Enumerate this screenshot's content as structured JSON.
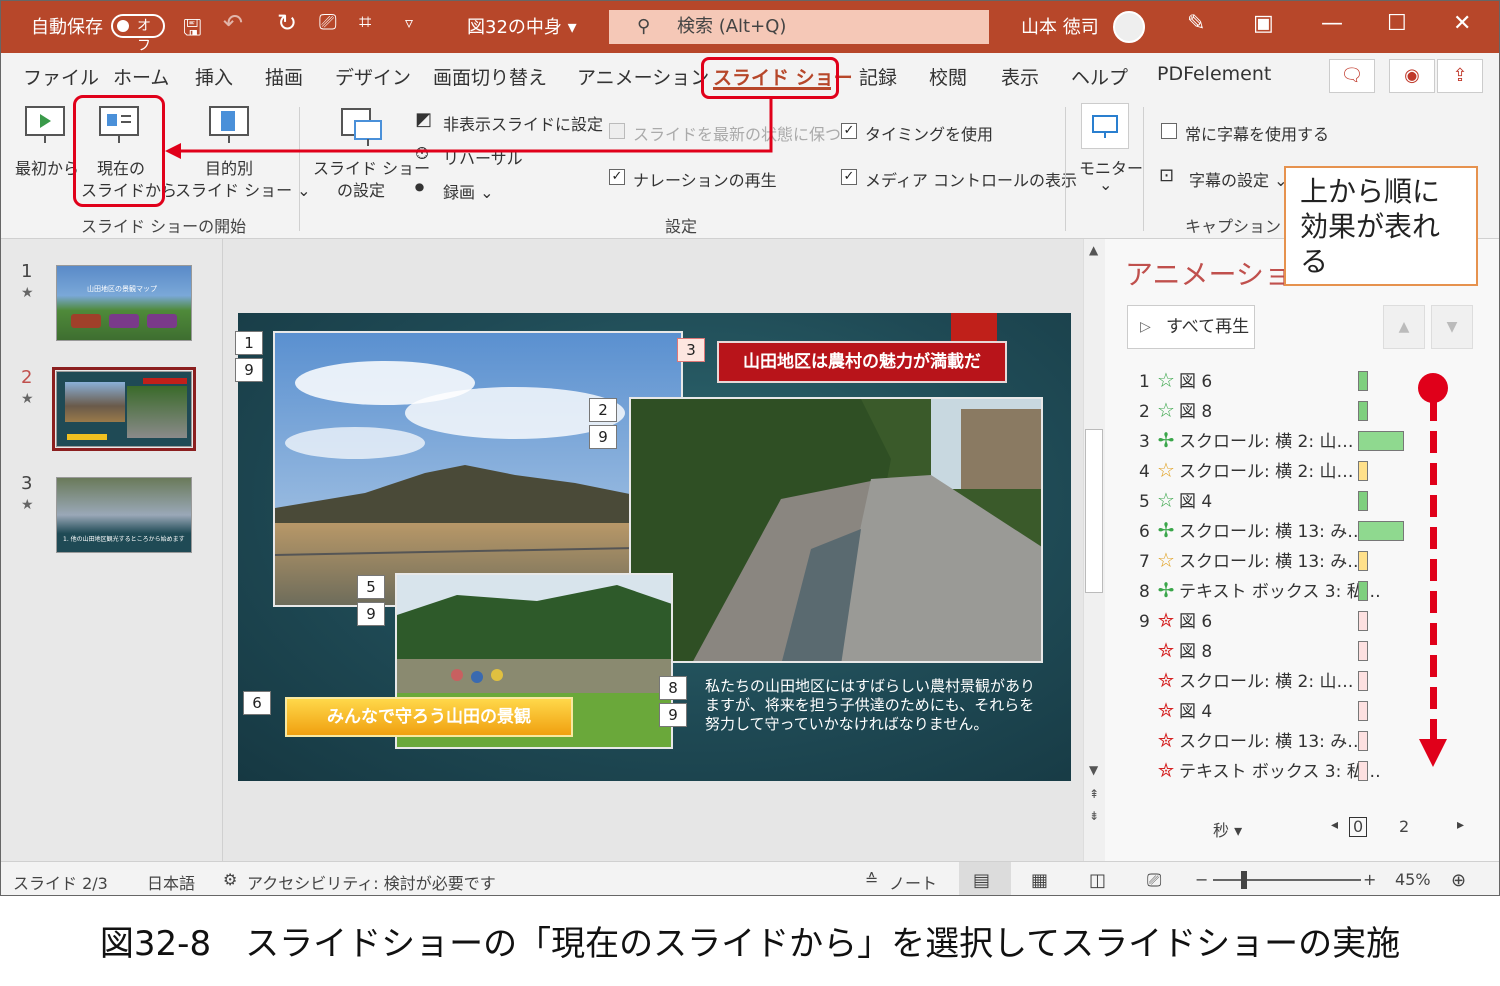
{
  "titlebar": {
    "autosave_label": "自動保存",
    "autosave_state": "オフ",
    "doc_title": "図32の中身",
    "search_placeholder": "検索 (Alt+Q)",
    "user_name": "山本 徳司"
  },
  "tabs": [
    "ファイル",
    "ホーム",
    "挿入",
    "描画",
    "デザイン",
    "画面切り替え",
    "アニメーション",
    "スライド ショー",
    "記録",
    "校閲",
    "表示",
    "ヘルプ",
    "PDFelement"
  ],
  "active_tab": "スライド ショー",
  "ribbon": {
    "start_group": {
      "from_beginning": "最初から",
      "from_current_1": "現在の",
      "from_current_2": "スライドから",
      "custom_1": "目的別",
      "custom_2": "スライド ショー ⌄",
      "label": "スライド ショーの開始"
    },
    "setup_group": {
      "setup_1": "スライド ショー",
      "setup_2": "の設定",
      "hide_slide": "非表示スライドに設定",
      "rehearse": "リハーサル",
      "record": "録画  ⌄",
      "keep_updated": "スライドを最新の状態に保つ",
      "play_narration": "ナレーションの再生",
      "use_timings": "タイミングを使用",
      "show_media_controls": "メディア コントロールの表示",
      "label": "設定"
    },
    "monitor_group": {
      "monitor": "モニター",
      "chevron": "⌄"
    },
    "captions_group": {
      "always_subtitles": "常に字幕を使用する",
      "subtitle_settings": "字幕の設定 ⌄",
      "label": "キャプションと字幕"
    }
  },
  "callout": "上から順に効果が表れる",
  "thumbnails": [
    {
      "number": "1",
      "star": "★",
      "title": "山田地区の景観マップ"
    },
    {
      "number": "2",
      "star": "★"
    },
    {
      "number": "3",
      "star": "★",
      "caption": "1. 他の山田地区観光するところから始めます"
    }
  ],
  "slide": {
    "banner_top": "山田地区は農村の魅力が満載だ",
    "banner_bottom": "みんなで守ろう山田の景観",
    "body_text": "私たちの山田地区にはすばらしい農村景観がありますが、将来を担う子供達のためにも、それらを努力して守っていかなければなりません。",
    "tags": {
      "t1": "1",
      "t9a": "9",
      "t2": "2",
      "t9b": "9",
      "t3": "3",
      "t5": "5",
      "t9c": "9",
      "t6": "6",
      "t8": "8",
      "t9d": "9"
    }
  },
  "animation_pane": {
    "title": "アニメーション",
    "play_all": "すべて再生",
    "items": [
      {
        "num": "1",
        "effect": "entrance",
        "label": "図 6",
        "bar_color": "#7fcf7f",
        "bar_len": 1
      },
      {
        "num": "2",
        "effect": "entrance",
        "label": "図 8",
        "bar_color": "#7fcf7f",
        "bar_len": 1
      },
      {
        "num": "3",
        "effect": "path",
        "label": "スクロール: 横 2: 山…",
        "bar_color": "#8fd98f",
        "bar_len": 4
      },
      {
        "num": "4",
        "effect": "emphasis",
        "label": "スクロール: 横 2: 山…",
        "bar_color": "#ffe08a",
        "bar_len": 1
      },
      {
        "num": "5",
        "effect": "entrance",
        "label": "図 4",
        "bar_color": "#7fcf7f",
        "bar_len": 1
      },
      {
        "num": "6",
        "effect": "path",
        "label": "スクロール: 横 13: み…",
        "bar_color": "#8fd98f",
        "bar_len": 4
      },
      {
        "num": "7",
        "effect": "emphasis",
        "label": "スクロール: 横 13: み…",
        "bar_color": "#ffe08a",
        "bar_len": 1
      },
      {
        "num": "8",
        "effect": "path",
        "label": "テキスト ボックス 3: 私…",
        "bar_color": "#7fcf7f",
        "bar_len": 1
      },
      {
        "num": "9",
        "effect": "exit",
        "label": "図 6",
        "bar_color": "#fde0e0",
        "bar_len": 1
      },
      {
        "num": "",
        "effect": "exit",
        "label": "図 8",
        "bar_color": "#fde0e0",
        "bar_len": 1
      },
      {
        "num": "",
        "effect": "exit",
        "label": "スクロール: 横 2: 山…",
        "bar_color": "#fde0e0",
        "bar_len": 1
      },
      {
        "num": "",
        "effect": "exit",
        "label": "図 4",
        "bar_color": "#fde0e0",
        "bar_len": 1
      },
      {
        "num": "",
        "effect": "exit",
        "label": "スクロール: 横 13: み…",
        "bar_color": "#fde0e0",
        "bar_len": 1
      },
      {
        "num": "",
        "effect": "exit",
        "label": "テキスト ボックス 3: 私…",
        "bar_color": "#fde0e0",
        "bar_len": 1
      }
    ],
    "seconds_label": "秒",
    "timeline_0": "0",
    "timeline_2": "2"
  },
  "statusbar": {
    "slide_info": "スライド 2/3",
    "language": "日本語",
    "accessibility": "アクセシビリティ: 検討が必要です",
    "notes": "ノート",
    "zoom": "45%"
  },
  "colors": {
    "accent": "#b7472a",
    "highlight": "#e0001a",
    "callout_border": "#e6924e"
  },
  "figure_caption": "図32-8　スライドショーの「現在のスライドから」を選択してスライドショーの実施"
}
